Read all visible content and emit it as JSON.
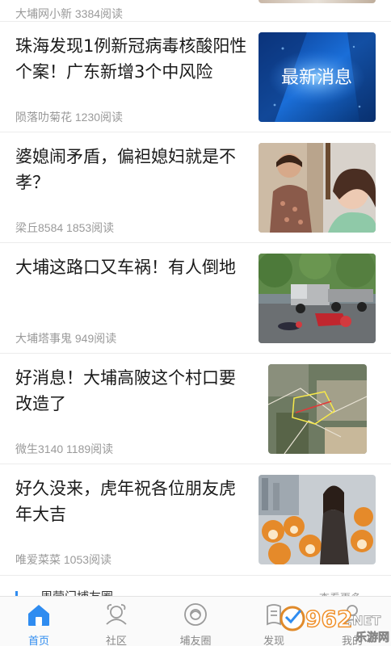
{
  "feed": {
    "items": [
      {
        "title": "",
        "meta": "大埔网小新 3384阅读"
      },
      {
        "title": "珠海发现1例新冠病毒核酸阳性个案！广东新增3个中风险",
        "meta": "陨落叻菊花 1230阅读",
        "thumb_text": "最新消息"
      },
      {
        "title": "婆媳闹矛盾，偏袒媳妇就是不孝？",
        "meta": "梁丘8584 1853阅读"
      },
      {
        "title": "大埔这路口又车祸！有人倒地",
        "meta": "大埔塔事鬼 949阅读"
      },
      {
        "title": "好消息！大埔高陂这个村口要改造了",
        "meta": "微生3140 1189阅读"
      },
      {
        "title": "好久没来，虎年祝各位朋友虎年大吉",
        "meta": "唯爱菜菜 1053阅读"
      }
    ]
  },
  "section": {
    "label": "周营门埔友圈",
    "more": "查看更多 ›"
  },
  "tabbar": {
    "tabs": [
      {
        "label": "首页",
        "icon": "home-icon",
        "active": true
      },
      {
        "label": "社区",
        "icon": "community-icon",
        "active": false
      },
      {
        "label": "埔友圈",
        "icon": "friends-circle-icon",
        "active": false
      },
      {
        "label": "发现",
        "icon": "discover-icon",
        "active": false
      },
      {
        "label": "我的",
        "icon": "profile-icon",
        "active": false
      }
    ]
  },
  "watermark": {
    "text_big": "962",
    "text_net": ".NET",
    "text_sub": "乐游网"
  },
  "colors": {
    "accent": "#2f8cf0",
    "meta": "#9a9a9a",
    "title": "#1a1a1a"
  }
}
